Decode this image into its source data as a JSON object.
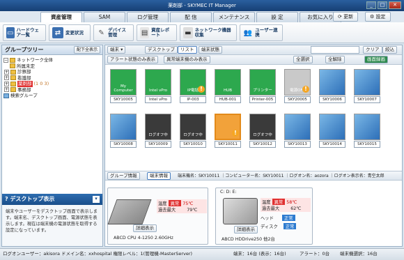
{
  "window": {
    "title": "薬剤部 - SKYMEC IT Manager"
  },
  "tabs": [
    "資産管理",
    "SAM",
    "ログ管理",
    "配 信",
    "メンテナンス",
    "設 定",
    "お気に入り"
  ],
  "top_buttons": {
    "refresh": "更新",
    "settings": "設定"
  },
  "toolbar": [
    {
      "label": "ハードウェア一覧",
      "icon": "hardware-icon"
    },
    {
      "label": "変更状況",
      "icon": "change-icon"
    },
    {
      "label": "デバイス管理",
      "icon": "device-icon"
    },
    {
      "label": "資産レポート",
      "icon": "report-icon"
    },
    {
      "label": "ネットワーク機器収集",
      "icon": "network-icon"
    },
    {
      "label": "ユーザー連携",
      "icon": "user-icon"
    }
  ],
  "group_tree": {
    "title": "グループツリー",
    "expand_all": "配下全表示",
    "nodes": [
      "ネットワーク全体",
      "所属未定",
      "診察部",
      "看護部",
      "薬剤部",
      "事務部",
      "検索グループ"
    ],
    "selected_counts": "(1 0 3)"
  },
  "main_toolbar": {
    "terminal": "端末",
    "desktop": "デスクトップ",
    "list": "リスト",
    "terminal_status": "端末状態",
    "clear": "クリア",
    "filter": "絞込",
    "alert_only": "アラート状態のみ表示",
    "abnormal_only": "異常端末機のみ表示",
    "select_all": "全選択",
    "deselect_all": "全解除",
    "screen_record": "画面録画"
  },
  "terminals": [
    {
      "name": "SKY10005",
      "screen": "My Computer",
      "warn": false,
      "selected": true
    },
    {
      "name": "Intel vPro",
      "screen": "Intel vPro",
      "warn": false,
      "selected": true
    },
    {
      "name": "IP-003",
      "screen": "IP電話",
      "warn": true,
      "selected": true
    },
    {
      "name": "HUB-001",
      "screen": "HUB",
      "warn": false,
      "selected": true
    },
    {
      "name": "Printer-005",
      "screen": "プリンター",
      "warn": false,
      "selected": true
    },
    {
      "name": "SKY20005",
      "screen": "電源OFF",
      "warn": true,
      "selected": false
    },
    {
      "name": "SKY10006",
      "screen": "",
      "warn": false,
      "selected": false
    },
    {
      "name": "SKY10007",
      "screen": "",
      "warn": false,
      "selected": false
    },
    {
      "name": "SKY10008",
      "screen": "",
      "warn": false,
      "selected": false
    },
    {
      "name": "SKY10009",
      "screen": "ログオフ中",
      "warn": false,
      "selected": false
    },
    {
      "name": "SKY10010",
      "screen": "ログオフ中",
      "warn": false,
      "selected": false
    },
    {
      "name": "SKY10011",
      "screen": "",
      "warn": true,
      "selected": false,
      "highlight": true
    },
    {
      "name": "SKY10012",
      "screen": "ログオフ中",
      "warn": false,
      "selected": false
    },
    {
      "name": "SKY10013",
      "screen": "",
      "warn": false,
      "selected": false
    },
    {
      "name": "SKY10014",
      "screen": "",
      "warn": false,
      "selected": false
    },
    {
      "name": "SKY10015",
      "screen": "",
      "warn": false,
      "selected": false
    }
  ],
  "detail": {
    "group_info": "グループ情報",
    "terminal_info": "端末情報",
    "info_line": "端末機名：SKY10011 ｜コンピューター名：SKY10011 ｜ログオン名：aozora ｜ログオン表示名：青空太郎",
    "cpu": {
      "temp_label": "温度",
      "overheat_label": "過去最大",
      "status": "異常",
      "temp": "75℃",
      "max": "79℃",
      "detail_btn": "詳細表示",
      "name": "ABCD CPU 4-1250 2.60GHz"
    },
    "hdd": {
      "drives": "C: D: E:",
      "temp_label": "温度",
      "overheat_label": "過去最大",
      "status": "異常",
      "temp": "58℃",
      "max": "62℃",
      "head_label": "ヘッド",
      "head_status": "正常",
      "disk_label": "ディスク",
      "disk_status": "正常",
      "detail_btn": "詳細表示",
      "name": "ABCD HDDrive250 他2台"
    }
  },
  "desktop_panel": {
    "title": "デスクトップ表示",
    "text": "端末やユーザーをデスクトップ画面で表示します。端末名、デスクトップ画面、電源状態を表示します。現在は端末機の電源状態を取得する設定になっています。"
  },
  "statusbar": {
    "user": "ログオンユーザー：akisora ドメイン名：xxhospital 権限レベル：1(管理機-MasterServer)",
    "terminals": "端末：",
    "terminals_val": "16台 (表示：16台)",
    "alerts": "アラート：",
    "alerts_val": "0台",
    "selected": "端末機選択：",
    "selected_val": "16台"
  }
}
